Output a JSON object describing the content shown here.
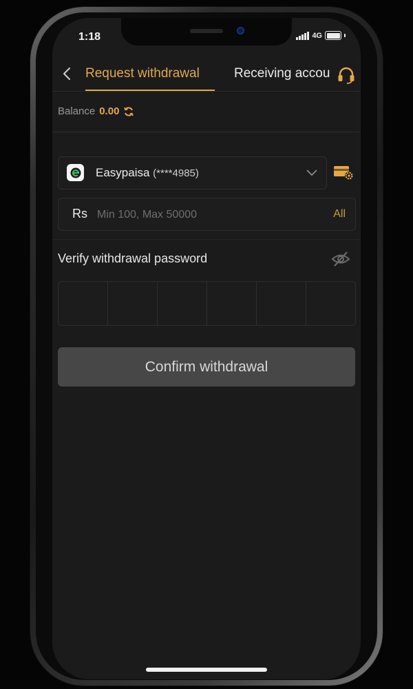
{
  "status_bar": {
    "time": "1:18",
    "network": "4G"
  },
  "nav": {
    "tabs": [
      {
        "label": "Request withdrawal",
        "active": true
      },
      {
        "label": "Receiving accou",
        "active": false
      }
    ],
    "back_icon": "chevron-left-icon",
    "support_icon": "headset-icon"
  },
  "balance": {
    "label": "Balance",
    "value": "0.00",
    "refresh_icon": "refresh-icon"
  },
  "account": {
    "name": "Easypaisa",
    "masked_number": "(****4985)",
    "logo_icon": "easypaisa-logo",
    "dropdown_icon": "chevron-down-icon",
    "settings_icon": "card-settings-icon"
  },
  "amount": {
    "currency": "Rs",
    "placeholder": "Min 100, Max 50000",
    "value": "",
    "all_label": "All"
  },
  "password": {
    "label": "Verify withdrawal password",
    "visibility_icon": "eye-off-icon",
    "digits": [
      "",
      "",
      "",
      "",
      "",
      ""
    ]
  },
  "confirm": {
    "label": "Confirm withdrawal"
  },
  "colors": {
    "accent": "#e2a84a",
    "screen_bg": "#1b1b1b",
    "button_bg": "#474747"
  }
}
